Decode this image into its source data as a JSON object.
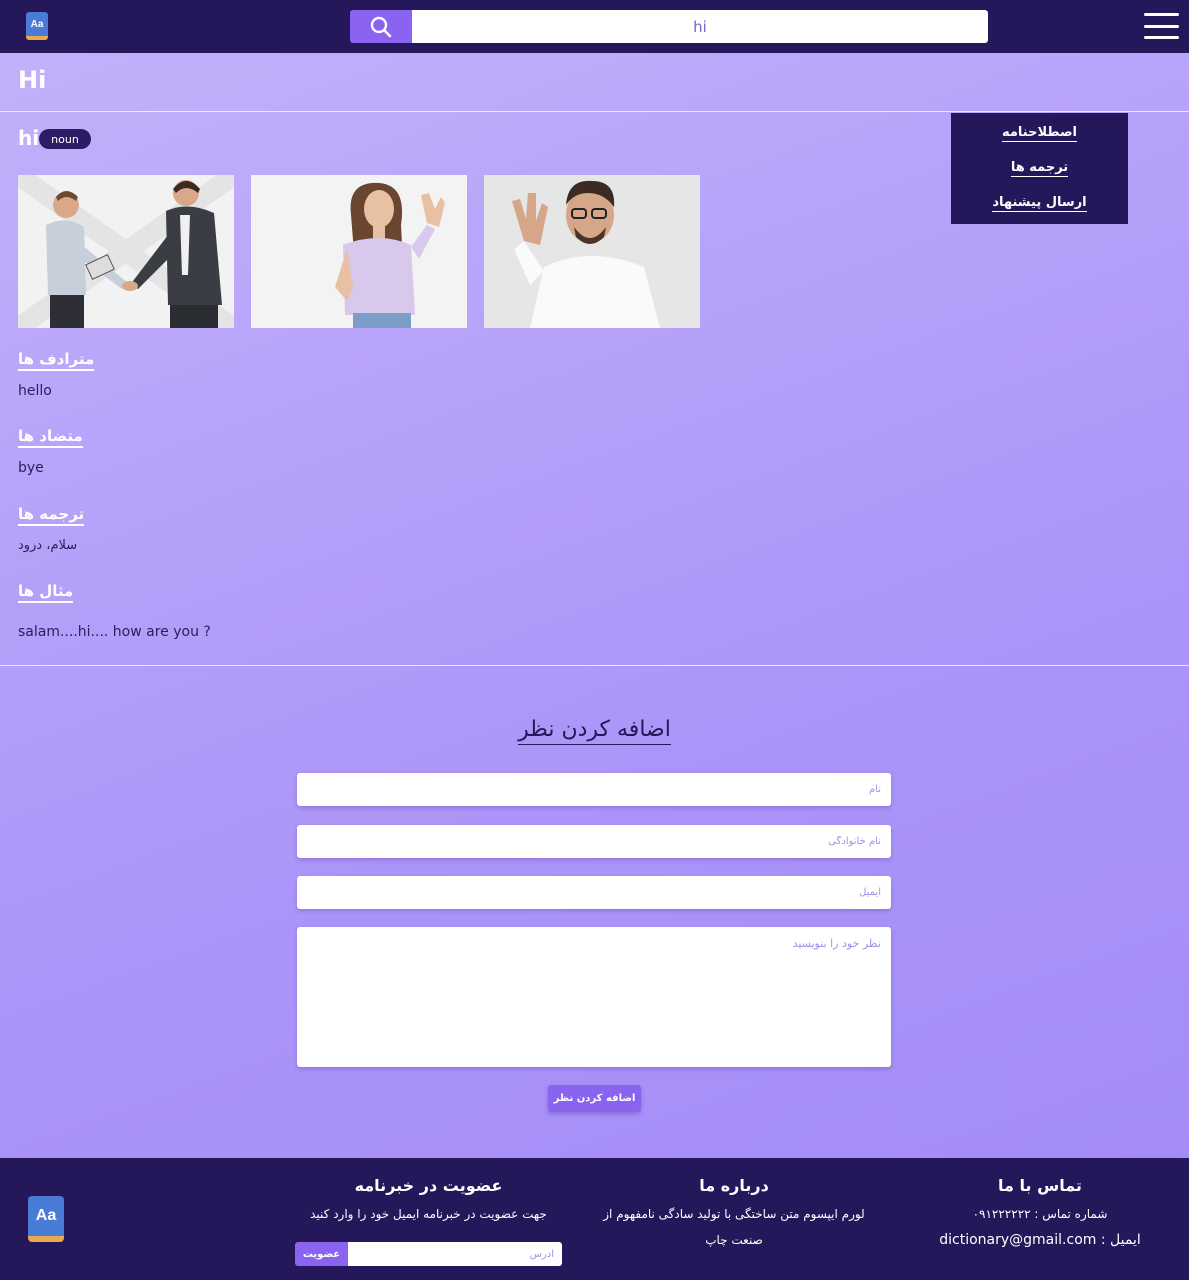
{
  "header": {
    "logo_text": "Aa",
    "search_value": "hi"
  },
  "entry": {
    "page_title": "Hi",
    "word": "hi",
    "part_of_speech": "noun"
  },
  "side_menu": {
    "items": [
      {
        "label": "اصطلاحنامه"
      },
      {
        "label": "ترجمه ها"
      },
      {
        "label": "ارسال پیشنهاد"
      }
    ]
  },
  "sections": {
    "synonyms": {
      "title": "مترادف ها",
      "value": "hello"
    },
    "antonyms": {
      "title": "متضاد ها",
      "value": "bye"
    },
    "translations": {
      "title": "ترجمه ها",
      "value": "سلام، درود"
    },
    "examples": {
      "title": "مثال ها",
      "value": "salam....hi.... how are you ?"
    }
  },
  "comment_form": {
    "title": "اضافه کردن نظر",
    "first_name_placeholder": "نام",
    "last_name_placeholder": "نام خانوادگی",
    "email_placeholder": "ایمیل",
    "comment_placeholder": "نظر خود را بنویسید",
    "submit_label": "اضافه کردن نظر"
  },
  "footer": {
    "logo_text": "Aa",
    "contact": {
      "title": "تماس با ما",
      "phone": "شماره تماس : ۰۹۱۲۲۲۲۲۲",
      "email": "ایمیل : dictionary@gmail.com"
    },
    "about": {
      "title": "درباره ما",
      "text": "لورم ایپسوم متن ساختگی با تولید سادگی نامفهوم از صنعت چاپ"
    },
    "newsletter": {
      "title": "عضویت در خبرنامه",
      "text": "جهت عضویت در خبرنامه ایمیل خود را وارد کنید",
      "input_placeholder": "آدرس",
      "button_label": "عضویت"
    }
  },
  "colors": {
    "topbar": "#24185a",
    "accent": "#8a63f0",
    "background": "#b09bf9"
  }
}
